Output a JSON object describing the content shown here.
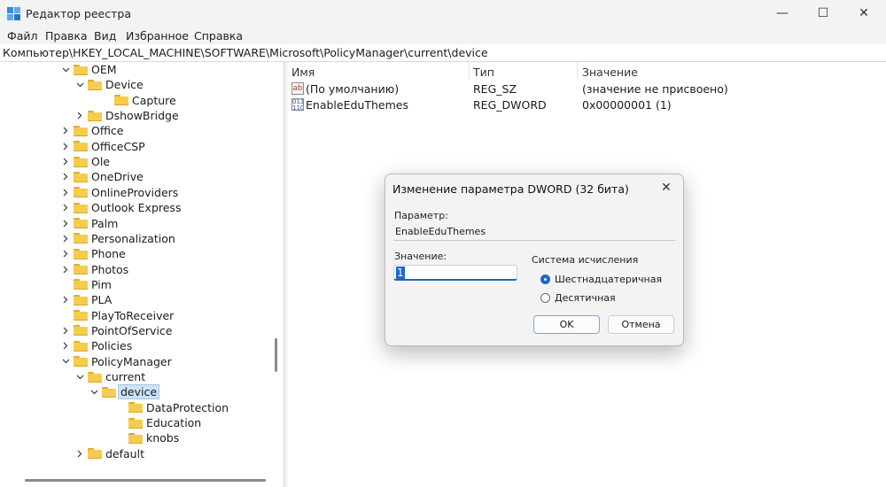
{
  "window": {
    "title": "Редактор реестра",
    "minimize": "—",
    "maximize": "☐",
    "close": "✕"
  },
  "menu": [
    "Файл",
    "Правка",
    "Вид",
    "Избранное",
    "Справка"
  ],
  "address": "Компьютер\\HKEY_LOCAL_MACHINE\\SOFTWARE\\Microsoft\\PolicyManager\\current\\device",
  "tree": [
    {
      "label": "OEM",
      "chevron": "down"
    },
    {
      "label": "Device",
      "chevron": "down"
    },
    {
      "label": "Capture",
      "chevron": ""
    },
    {
      "label": "DshowBridge",
      "chevron": "right"
    },
    {
      "label": "Office",
      "chevron": "right"
    },
    {
      "label": "OfficeCSP",
      "chevron": "right"
    },
    {
      "label": "Ole",
      "chevron": "right"
    },
    {
      "label": "OneDrive",
      "chevron": "right"
    },
    {
      "label": "OnlineProviders",
      "chevron": "right"
    },
    {
      "label": "Outlook Express",
      "chevron": "right"
    },
    {
      "label": "Palm",
      "chevron": "right"
    },
    {
      "label": "Personalization",
      "chevron": "right"
    },
    {
      "label": "Phone",
      "chevron": "right"
    },
    {
      "label": "Photos",
      "chevron": "right"
    },
    {
      "label": "Pim",
      "chevron": ""
    },
    {
      "label": "PLA",
      "chevron": "right"
    },
    {
      "label": "PlayToReceiver",
      "chevron": ""
    },
    {
      "label": "PointOfService",
      "chevron": "right"
    },
    {
      "label": "Policies",
      "chevron": "right"
    },
    {
      "label": "PolicyManager",
      "chevron": "down"
    },
    {
      "label": "current",
      "chevron": "down"
    },
    {
      "label": "device",
      "chevron": "down",
      "selected": true
    },
    {
      "label": "DataProtection",
      "chevron": ""
    },
    {
      "label": "Education",
      "chevron": ""
    },
    {
      "label": "knobs",
      "chevron": ""
    },
    {
      "label": "default",
      "chevron": "right"
    }
  ],
  "list": {
    "headers": {
      "name": "Имя",
      "type": "Тип",
      "value": "Значение"
    },
    "rows": [
      {
        "icon": "string-value-icon",
        "name": "(По умолчанию)",
        "type": "REG_SZ",
        "value": "(значение не присвоено)"
      },
      {
        "icon": "binary-value-icon",
        "name": "EnableEduThemes",
        "type": "REG_DWORD",
        "value": "0x00000001 (1)"
      }
    ]
  },
  "dialog": {
    "title": "Изменение параметра DWORD (32 бита)",
    "param_label": "Параметр:",
    "param_value": "EnableEduThemes",
    "value_label": "Значение:",
    "value": "1",
    "radix_label": "Система исчисления",
    "radix_options": [
      "Шестнадцатеричная",
      "Десятичная"
    ],
    "radix_selected": "Шестнадцатеричная",
    "ok": "OK",
    "cancel": "Отмена"
  },
  "colors": {
    "accent": "#1f66c7",
    "folder": "#f6cc4e",
    "selection": "#cde3f7"
  }
}
